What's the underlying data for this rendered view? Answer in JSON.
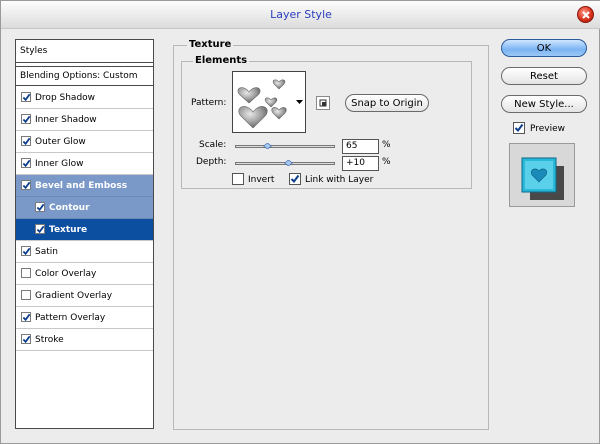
{
  "window": {
    "title": "Layer Style"
  },
  "styles_panel": {
    "header": "Styles",
    "blending_options": "Blending Options: Custom",
    "items": [
      {
        "label": "Drop Shadow",
        "checked": true
      },
      {
        "label": "Inner Shadow",
        "checked": true
      },
      {
        "label": "Outer Glow",
        "checked": true
      },
      {
        "label": "Inner Glow",
        "checked": true
      },
      {
        "label": "Bevel and Emboss",
        "checked": true
      },
      {
        "label": "Contour",
        "checked": true
      },
      {
        "label": "Texture",
        "checked": true
      },
      {
        "label": "Satin",
        "checked": true
      },
      {
        "label": "Color Overlay",
        "checked": false
      },
      {
        "label": "Gradient Overlay",
        "checked": false
      },
      {
        "label": "Pattern Overlay",
        "checked": true
      },
      {
        "label": "Stroke",
        "checked": true
      }
    ]
  },
  "texture": {
    "group_title": "Texture",
    "elements_title": "Elements",
    "pattern_label": "Pattern:",
    "snap_button": "Snap to Origin",
    "scale_label": "Scale:",
    "scale_value": "65",
    "scale_unit": "%",
    "scale_slider_fraction": 0.32,
    "depth_label": "Depth:",
    "depth_value": "+10",
    "depth_unit": "%",
    "depth_slider_fraction": 0.53,
    "invert_label": "Invert",
    "invert_checked": false,
    "link_label": "Link with Layer",
    "link_checked": true
  },
  "actions": {
    "ok": "OK",
    "reset": "Reset",
    "new_style": "New Style...",
    "preview_label": "Preview",
    "preview_checked": true
  },
  "colors": {
    "title_text": "#2a3cc0",
    "selection_active": "#0c4ea0",
    "selection_group": "#7a98c8",
    "ok_button": "#7bb4f2",
    "checkmark": "#0c3e8c",
    "preview_swatch": "#2ab8d8"
  },
  "icons": [
    "close-icon",
    "checkmark-icon",
    "dropdown-arrow-icon",
    "new-preset-icon",
    "heart-pattern-icon",
    "preview-swatch-icon"
  ]
}
